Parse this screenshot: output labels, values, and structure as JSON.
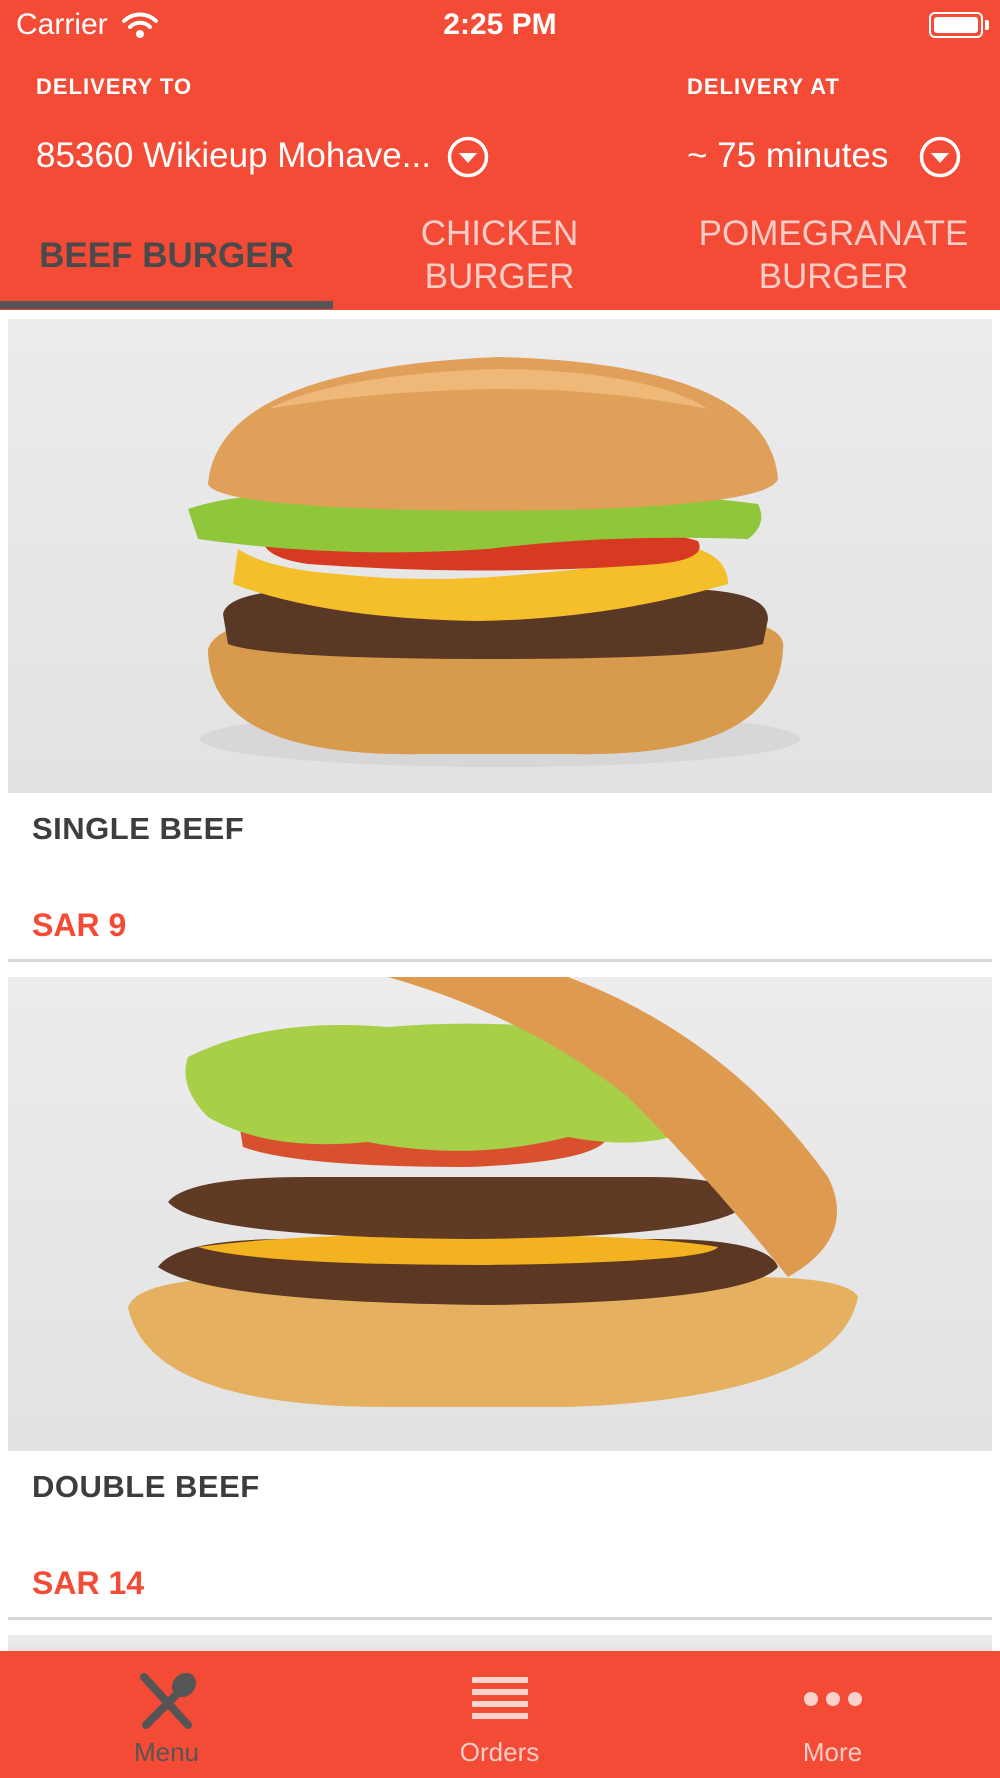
{
  "status_bar": {
    "carrier": "Carrier",
    "time": "2:25 PM"
  },
  "delivery": {
    "to_label": "DELIVERY TO",
    "to_value": "85360 Wikieup Mohave...",
    "at_label": "DELIVERY AT",
    "at_value": "~ 75 minutes"
  },
  "tabs": [
    {
      "label": "BEEF BURGER",
      "active": true
    },
    {
      "label": "CHICKEN\nBURGER",
      "active": false
    },
    {
      "label": "POMEGRANATE\nBURGER",
      "active": false
    }
  ],
  "menu_items": [
    {
      "name": "SINGLE BEEF",
      "price": "SAR 9"
    },
    {
      "name": "DOUBLE BEEF",
      "price": "SAR 14"
    }
  ],
  "tabbar": [
    {
      "label": "Menu",
      "icon": "fork-spoon-icon",
      "active": true
    },
    {
      "label": "Orders",
      "icon": "list-icon",
      "active": false
    },
    {
      "label": "More",
      "icon": "more-dots-icon",
      "active": false
    }
  ],
  "colors": {
    "brand": "#F44B36",
    "active_tab_text": "#4A4A4A",
    "tab_indicator": "#555555",
    "price": "#F44B36"
  },
  "icons": {
    "address_dropdown": "chevron-down-circle-icon",
    "time_dropdown": "chevron-down-circle-icon",
    "wifi": "wifi-icon",
    "battery": "battery-icon"
  }
}
